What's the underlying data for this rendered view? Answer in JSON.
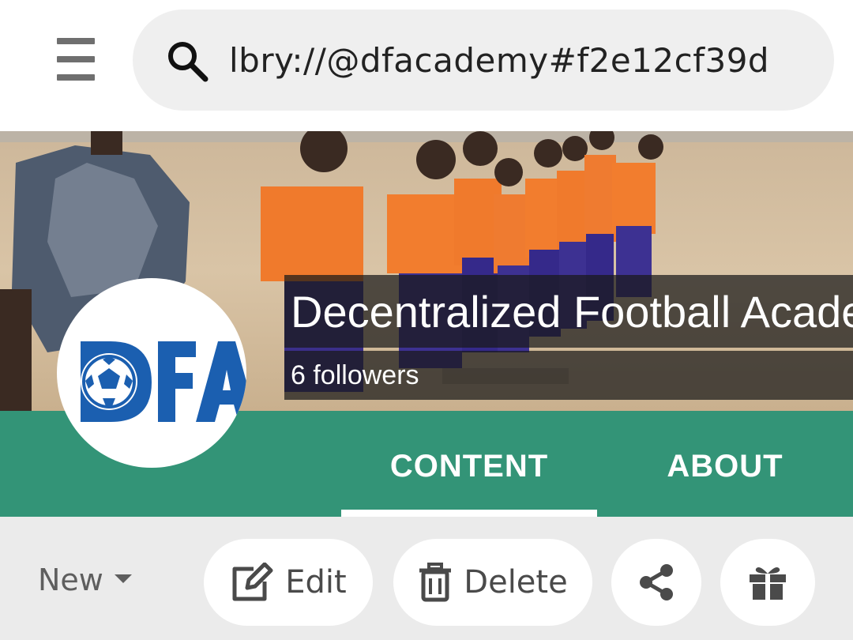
{
  "header": {
    "menu_icon": "hamburger-menu-icon",
    "search": {
      "icon": "search-icon",
      "value": "lbry://@dfacademy#f2e12cf39d"
    }
  },
  "channel": {
    "title": "Decentralized Football Academy",
    "followers": "6 followers",
    "avatar_text": "DFA",
    "avatar_color": "#1b5fb0"
  },
  "tabs": [
    {
      "label": "CONTENT",
      "active": true
    },
    {
      "label": "ABOUT",
      "active": false
    }
  ],
  "toolbar": {
    "sort_label": "New",
    "edit_label": "Edit",
    "delete_label": "Delete",
    "share_icon": "share-icon",
    "gift_icon": "gift-icon"
  },
  "colors": {
    "tab_bar": "#339477",
    "action_bar": "#ebebeb",
    "search_bg": "#efefef"
  }
}
